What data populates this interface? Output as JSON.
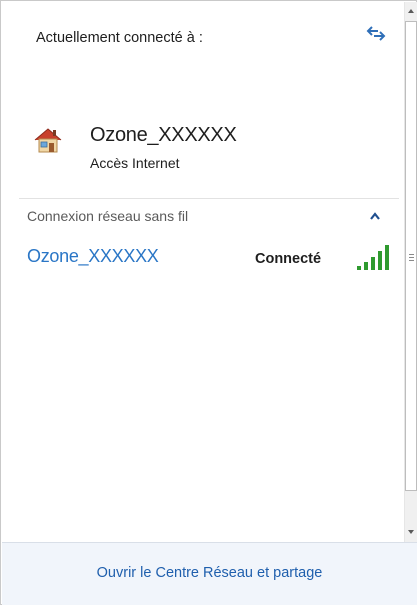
{
  "header": {
    "title": "Actuellement connecté à :",
    "refresh_icon": "refresh-arrows-icon"
  },
  "current_network": {
    "icon": "house-icon",
    "name": "Ozone_XXXXXX",
    "access": "Accès Internet"
  },
  "wireless_section": {
    "title": "Connexion réseau sans fil",
    "collapse_icon": "chevron-up-icon",
    "networks": [
      {
        "name": "Ozone_XXXXXX",
        "status": "Connecté",
        "signal_bars": 5,
        "signal_max": 5
      }
    ]
  },
  "footer": {
    "link": "Ouvrir le Centre Réseau et partage"
  },
  "colors": {
    "link_blue": "#2a76c6",
    "footer_link": "#1f5fad",
    "signal_green": "#2f9a2f",
    "footer_bg": "#f1f5fb"
  }
}
